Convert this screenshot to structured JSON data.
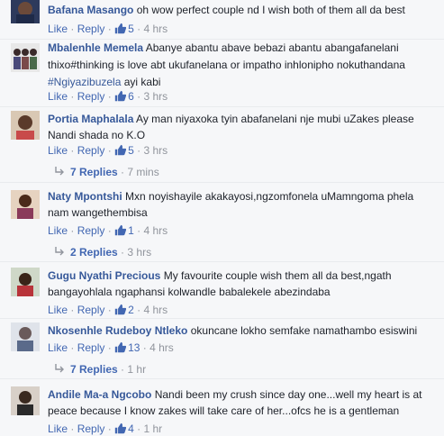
{
  "comments": [
    {
      "author": "Bafana Masango",
      "text": "oh wow perfect couple nd I wish both of them all da best",
      "like_label": "Like",
      "reply_label": "Reply",
      "likes": "5",
      "time": "4 hrs"
    },
    {
      "author": "Mbalenhle Memela",
      "text": "Abanye abantu abave bebazi abantu abangafanelani thixo#thinking is love abt ukufanelana or impatho inhlonipho nokuthandana",
      "hashtag": "#Ngiyazibuzela",
      "text_tail": "ayi kabi",
      "like_label": "Like",
      "reply_label": "Reply",
      "likes": "6",
      "time": "3 hrs"
    },
    {
      "author": "Portia Maphalala",
      "text": "Ay man niyaxoka tyin abafanelani nje mubi uZakes please Nandi shada no K.O",
      "like_label": "Like",
      "reply_label": "Reply",
      "likes": "5",
      "time": "3 hrs",
      "replies_label": "7 Replies",
      "replies_time": "7 mins"
    },
    {
      "author": "Naty Mpontshi",
      "text": "Mxn noyishayile akakayosi,ngzomfonela uMamngoma phela nam wangethembisa",
      "like_label": "Like",
      "reply_label": "Reply",
      "likes": "1",
      "time": "4 hrs",
      "replies_label": "2 Replies",
      "replies_time": "3 hrs"
    },
    {
      "author": "Gugu Nyathi Precious",
      "text": "My favourite couple wish them all da best,ngath bangayohlala ngaphansi kolwandle babalekele abezindaba",
      "like_label": "Like",
      "reply_label": "Reply",
      "likes": "2",
      "time": "4 hrs"
    },
    {
      "author": "Nkosenhle Rudeboy Ntleko",
      "text": "okuncane lokho semfake namathambo esiswini",
      "like_label": "Like",
      "reply_label": "Reply",
      "likes": "13",
      "time": "4 hrs",
      "replies_label": "7 Replies",
      "replies_time": "1 hr"
    },
    {
      "author": "Andile Ma-a Ngcobo",
      "text": "Nandi been my crush since day one...well my heart is at peace because I know zakes will take care of her...ofcs he is a gentleman",
      "like_label": "Like",
      "reply_label": "Reply",
      "likes": "4",
      "time": "1 hr"
    }
  ],
  "separator": "·",
  "colors": {
    "link": "#365899",
    "meta": "#90949c",
    "background": "#f6f7f9"
  }
}
